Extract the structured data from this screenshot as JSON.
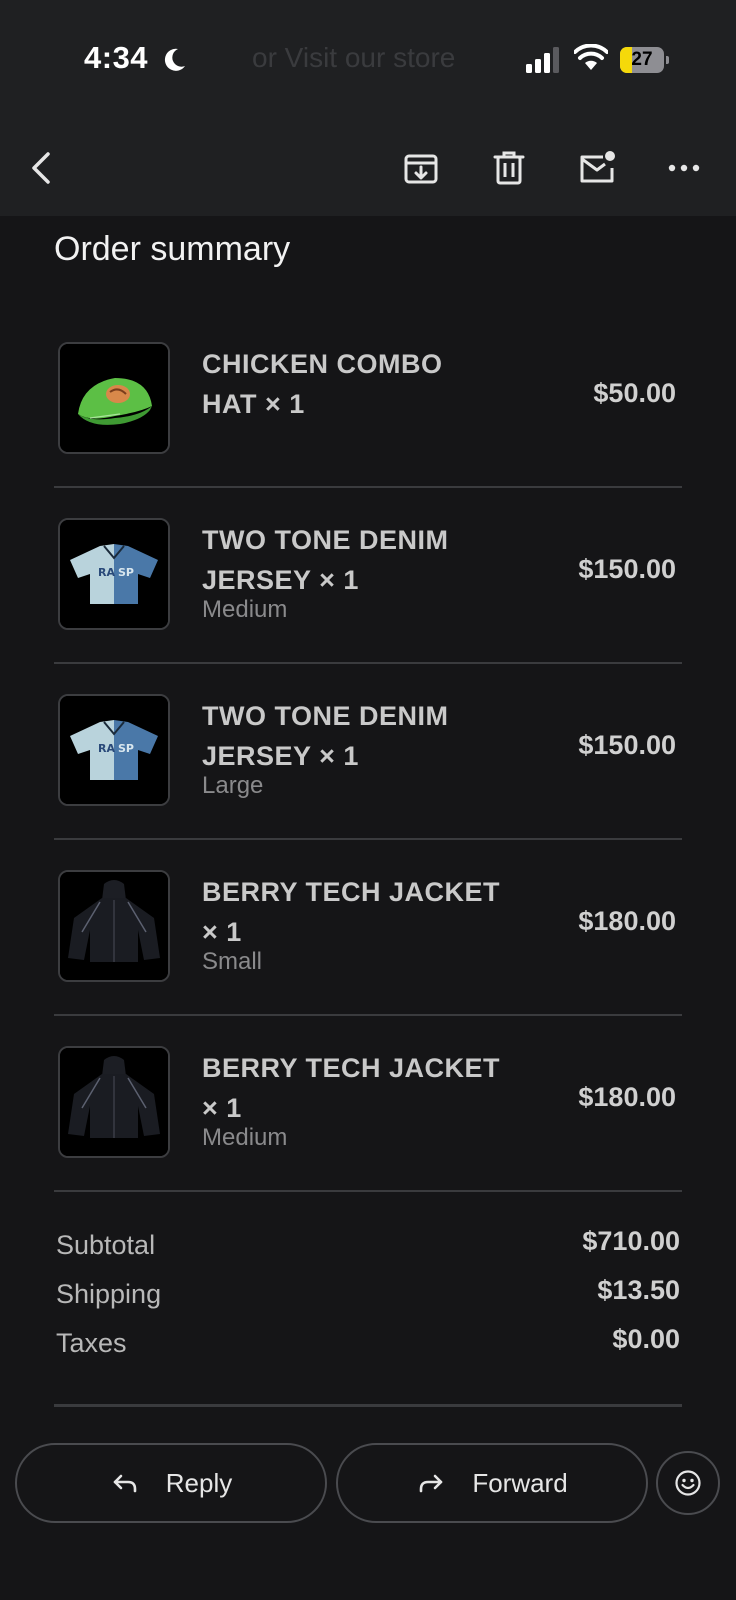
{
  "status_bar": {
    "time": "4:34",
    "background_text": "or Visit our store",
    "battery_percent": "27",
    "battery_level": 0.27,
    "battery_color": "#f5d90a"
  },
  "toolbar": {
    "back": "back-arrow-icon",
    "archive": "archive-icon",
    "delete": "trash-icon",
    "mark_unread": "mail-unread-icon",
    "more": "more-icon"
  },
  "summary": {
    "title": "Order summary",
    "items": [
      {
        "name": "CHICKEN COMBO HAT × 1",
        "variant": "",
        "price": "$50.00",
        "image": "green-hat"
      },
      {
        "name": "TWO TONE DENIM JERSEY × 1",
        "variant": "Medium",
        "price": "$150.00",
        "image": "denim-jersey"
      },
      {
        "name": "TWO TONE DENIM JERSEY × 1",
        "variant": "Large",
        "price": "$150.00",
        "image": "denim-jersey"
      },
      {
        "name": "BERRY TECH JACKET × 1",
        "variant": "Small",
        "price": "$180.00",
        "image": "black-jacket"
      },
      {
        "name": "BERRY TECH JACKET × 1",
        "variant": "Medium",
        "price": "$180.00",
        "image": "black-jacket"
      }
    ],
    "totals": [
      {
        "label": "Subtotal",
        "value": "$710.00"
      },
      {
        "label": "Shipping",
        "value": "$13.50"
      },
      {
        "label": "Taxes",
        "value": "$0.00"
      }
    ]
  },
  "actions": {
    "reply_label": "Reply",
    "forward_label": "Forward",
    "emoji": "emoji-reaction-icon"
  }
}
